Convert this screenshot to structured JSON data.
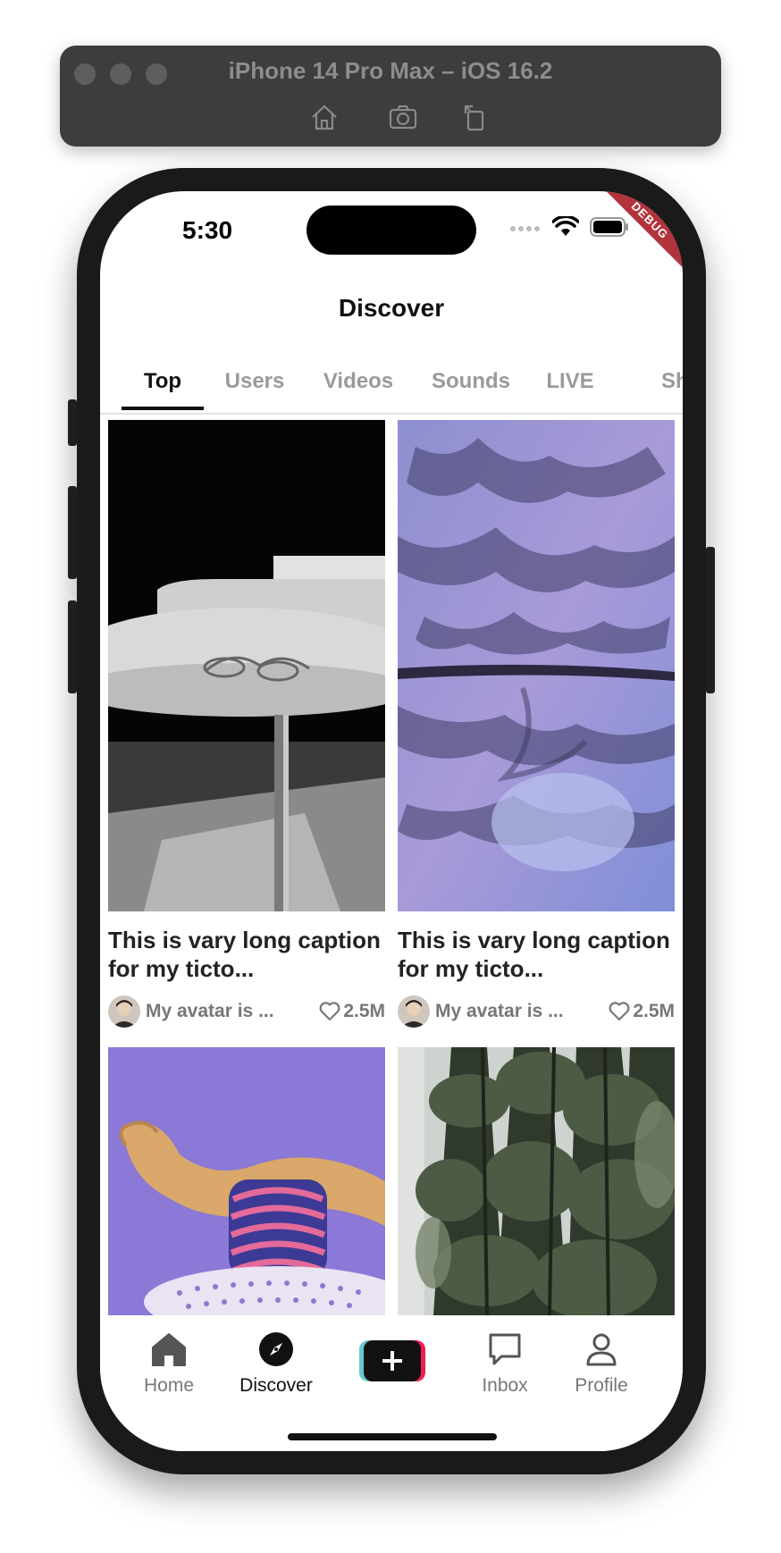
{
  "simulator": {
    "title": "iPhone 14 Pro Max – iOS 16.2"
  },
  "status_bar": {
    "time": "5:30",
    "debug_label": "DEBUG"
  },
  "header": {
    "title": "Discover"
  },
  "tabs": [
    {
      "label": "Top",
      "active": true
    },
    {
      "label": "Users",
      "active": false
    },
    {
      "label": "Videos",
      "active": false
    },
    {
      "label": "Sounds",
      "active": false
    },
    {
      "label": "LIVE",
      "active": false
    },
    {
      "label": "Sh",
      "active": false
    }
  ],
  "videos": [
    {
      "caption": "This is vary long caption for my ticto...",
      "author": "My avatar is ...",
      "likes": "2.5M",
      "thumbnail": "table-with-glasses"
    },
    {
      "caption": "This is vary long caption for my ticto...",
      "author": "My avatar is ...",
      "likes": "2.5M",
      "thumbnail": "snowy-mountains-aerial"
    },
    {
      "caption": "",
      "author": "",
      "likes": "",
      "thumbnail": "purple-3d-abstract"
    },
    {
      "caption": "",
      "author": "",
      "likes": "",
      "thumbnail": "forest-trees"
    }
  ],
  "bottom_nav": [
    {
      "label": "Home",
      "icon": "home-icon",
      "active": false
    },
    {
      "label": "Discover",
      "icon": "compass-icon",
      "active": true
    },
    {
      "label": "",
      "icon": "plus-icon",
      "active": false
    },
    {
      "label": "Inbox",
      "icon": "chat-bubble-icon",
      "active": false
    },
    {
      "label": "Profile",
      "icon": "person-icon",
      "active": false
    }
  ],
  "colors": {
    "create_left": "#69c9d0",
    "create_right": "#ee1d52",
    "text_primary": "#111111",
    "text_muted": "#777777"
  }
}
